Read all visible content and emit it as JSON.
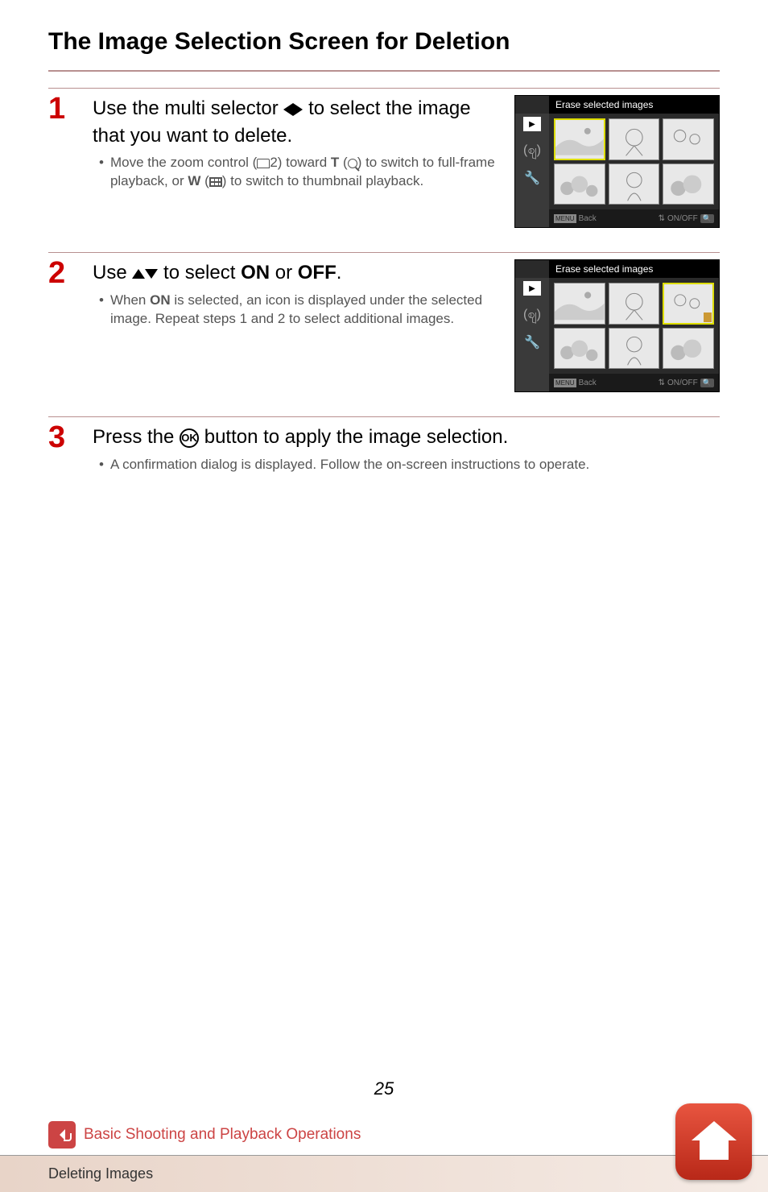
{
  "title": "The Image Selection Screen for Deletion",
  "steps": [
    {
      "num": "1",
      "heading_parts": [
        "Use the multi selector ",
        " to select the image that you want to delete."
      ],
      "bullet_parts": [
        "Move the zoom control (",
        "2) toward ",
        "T",
        " (",
        ") to switch to full-frame playback, or ",
        "W",
        " (",
        ") to switch to thumbnail playback."
      ]
    },
    {
      "num": "2",
      "heading_parts": [
        "Use ",
        " to select ",
        "ON",
        " or ",
        "OFF",
        "."
      ],
      "bullet": "When ON is selected, an icon is displayed under the selected image. Repeat steps 1 and 2 to select additional images.",
      "bullet_bold": "ON"
    },
    {
      "num": "3",
      "heading_parts": [
        "Press the ",
        " button to apply the image selection."
      ],
      "bullet": "A confirmation dialog is displayed. Follow the on-screen instructions to operate."
    }
  ],
  "camera_screen": {
    "header": "Erase selected images",
    "back_label": "Back",
    "menu_label": "MENU",
    "onoff_label": "ON/OFF"
  },
  "page_number": "25",
  "breadcrumb": "Basic Shooting and Playback Operations",
  "footer_text": "Deleting Images",
  "ok_label": "OK"
}
